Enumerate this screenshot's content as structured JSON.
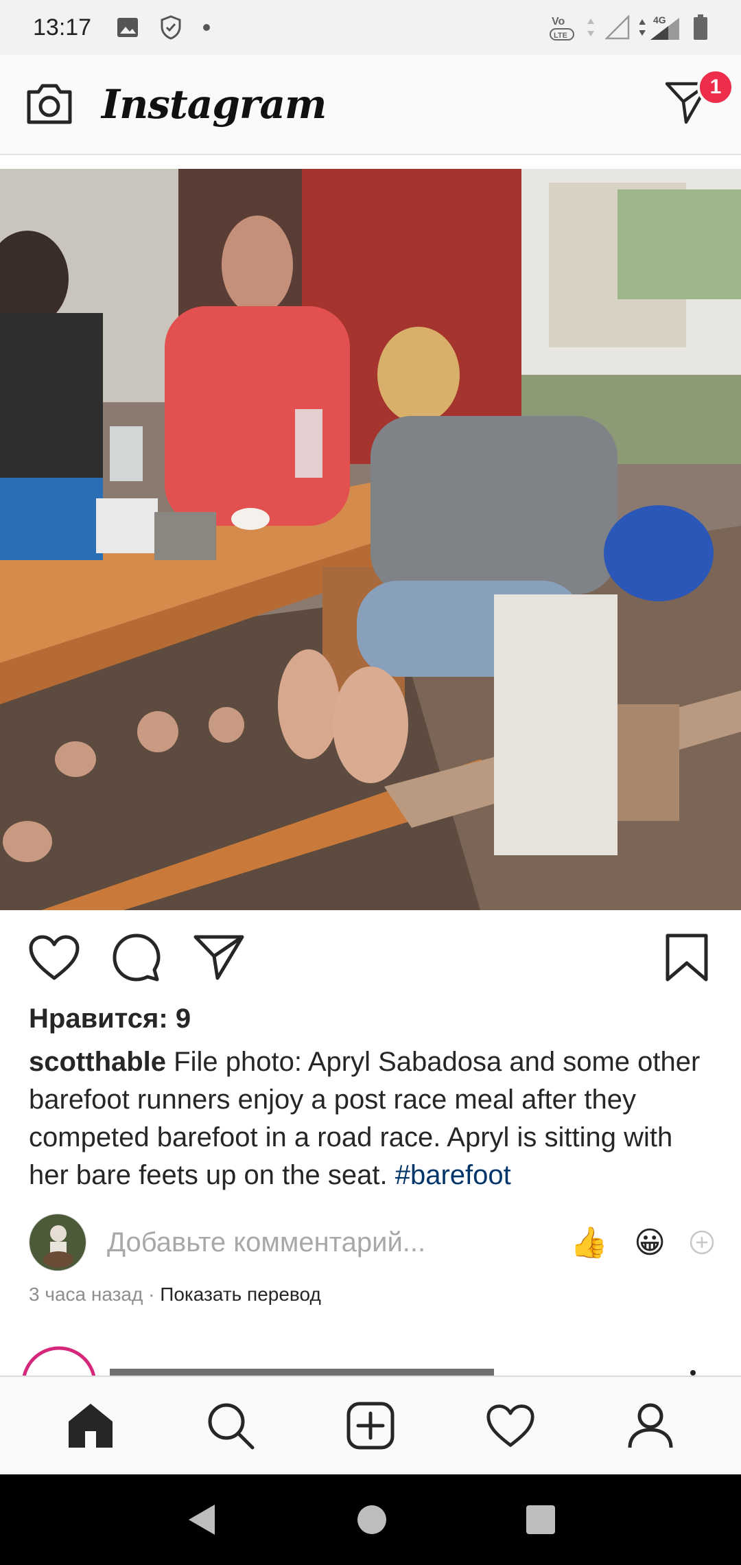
{
  "status_bar": {
    "time": "13:17",
    "network": "4G",
    "volte": "VoLTE"
  },
  "header": {
    "app_name": "Instagram",
    "dm_badge_count": "1"
  },
  "post": {
    "likes_text": "Нравится: 9",
    "username": "scotthable",
    "caption": "File photo: Apryl Sabadosa and some other barefoot runners enjoy a post race meal after they competed barefoot in a road race. Apryl is sitting with her bare feets up on the seat.",
    "hashtag": "#barefoot",
    "comment_placeholder": "Добавьте комментарий...",
    "emoji_1": "👍",
    "emoji_2": "😀",
    "time_ago": "3 часа назад",
    "separator": "·",
    "translate_link": "Показать перевод"
  },
  "colors": {
    "badge": "#ed2d49",
    "hashtag": "#003569",
    "muted": "#8e8e8e"
  }
}
